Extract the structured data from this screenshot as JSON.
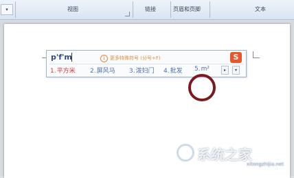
{
  "ribbon": {
    "groups": [
      {
        "label": "视图"
      },
      {
        "label": "链接"
      },
      {
        "label": "页眉和页脚"
      },
      {
        "label": "文本"
      }
    ]
  },
  "ime": {
    "composition": "p'f'm",
    "hint_number": "1",
    "hint": "更多特殊符号 (分号+F)",
    "logo": "S",
    "candidates": [
      {
        "num": "1.",
        "text": "平方米",
        "selected": true
      },
      {
        "num": "2.",
        "text": "屏风马"
      },
      {
        "num": "3.",
        "text": "泼妇门"
      },
      {
        "num": "4.",
        "text": "批发"
      },
      {
        "num": "5.",
        "text": "m²"
      }
    ],
    "next_page": "▸",
    "menu": "▾"
  },
  "watermark": {
    "text": "系统之家",
    "url": "xitongzhijia.net"
  }
}
